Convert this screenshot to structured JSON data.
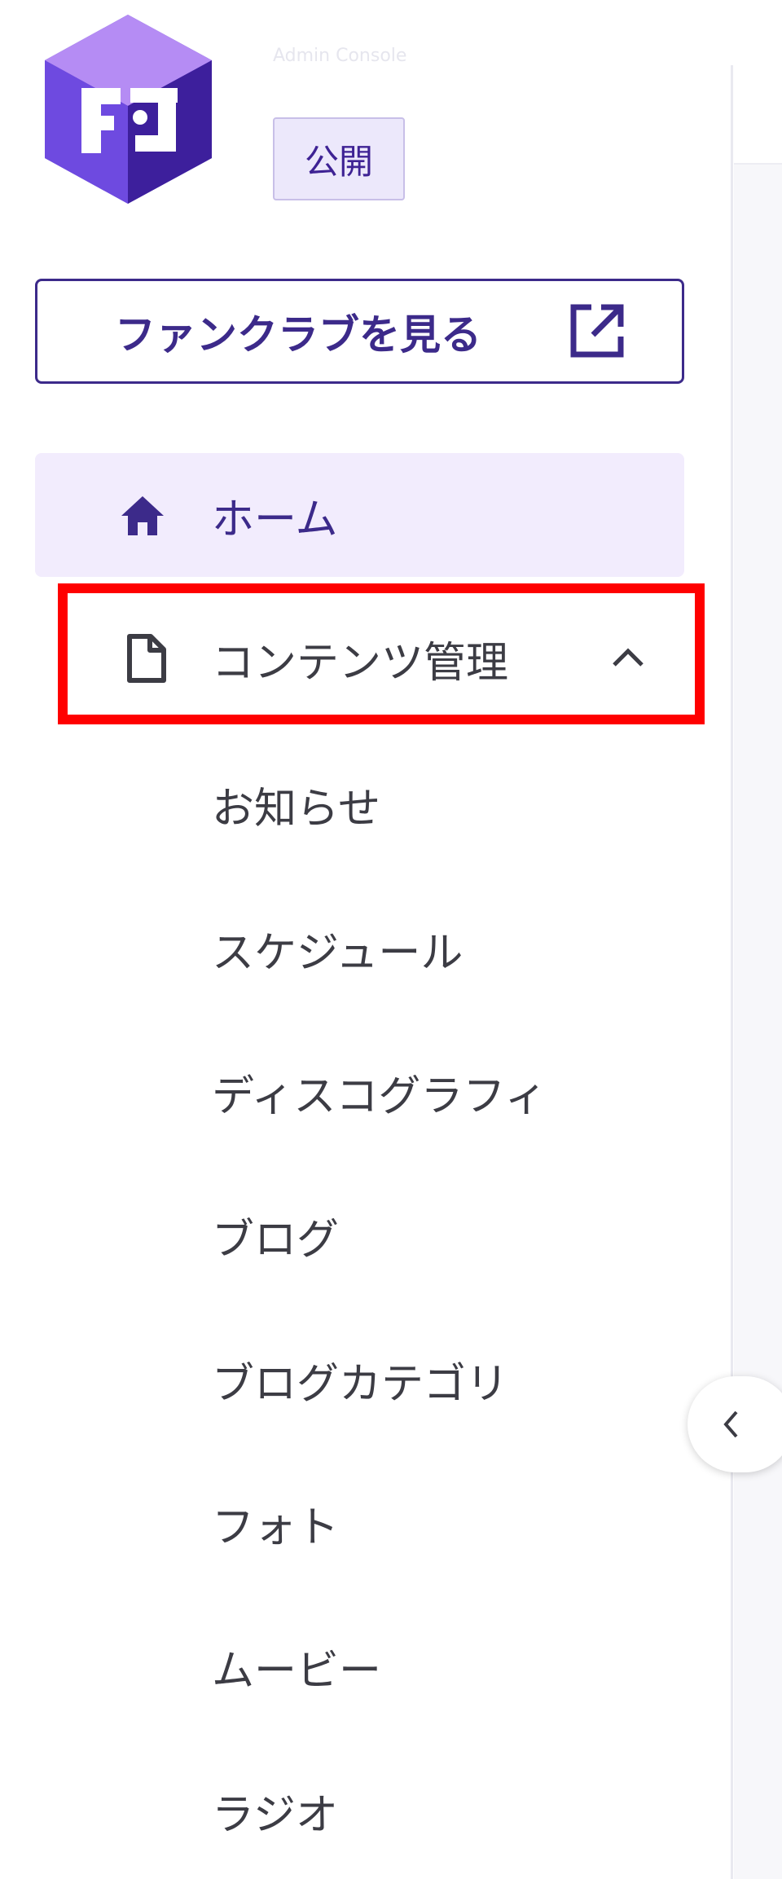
{
  "sidebar": {
    "app_name": "Admin Console",
    "status_badge": "公開",
    "view_button_label": "ファンクラブを見る",
    "nav": {
      "home": "ホーム",
      "content_management": "コンテンツ管理"
    },
    "submenu": [
      "お知らせ",
      "スケジュール",
      "ディスコグラフィ",
      "ブログ",
      "ブログカテゴリ",
      "フォト",
      "ムービー",
      "ラジオ"
    ]
  },
  "colors": {
    "accent": "#3c2a8a",
    "active_bg": "#f2ecfd",
    "badge_bg": "#ece8fb",
    "highlight": "#ff0000",
    "logo_light": "#b58cf4",
    "logo_dark": "#3d1f9c"
  },
  "icons": {
    "logo": "fanclub-logo-icon",
    "external": "external-link-icon",
    "home": "home-icon",
    "document": "document-icon",
    "expand": "chevron-up-icon",
    "collapse": "chevron-left-icon"
  }
}
